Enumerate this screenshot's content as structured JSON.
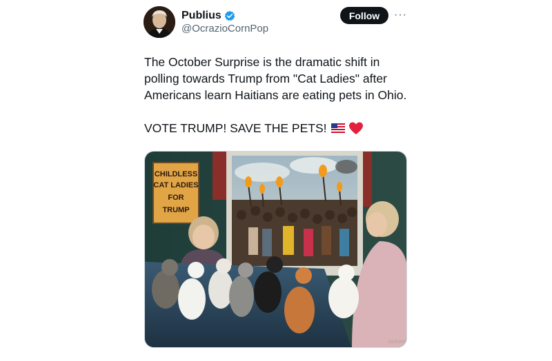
{
  "author": {
    "name": "Publius",
    "handle": "@OcrazioCornPop",
    "verified": true,
    "verified_color": "#1d9bf0",
    "avatar_icon": "portrait-avatar"
  },
  "actions": {
    "follow_label": "Follow",
    "more_label": "···"
  },
  "tweet": {
    "text_line1": "The October Surprise is the dramatic shift in polling towards Trump from \"Cat Ladies\" after Americans learn Haitians are eating pets in Ohio.",
    "text_line2": "VOTE TRUMP!  SAVE THE PETS!",
    "emojis": [
      "us-flag-emoji",
      "red-heart-emoji"
    ]
  },
  "media": {
    "sign_lines": [
      "CHILDLESS",
      "CAT LADIES",
      "FOR",
      "TRUMP"
    ],
    "signature": "Jackson"
  }
}
